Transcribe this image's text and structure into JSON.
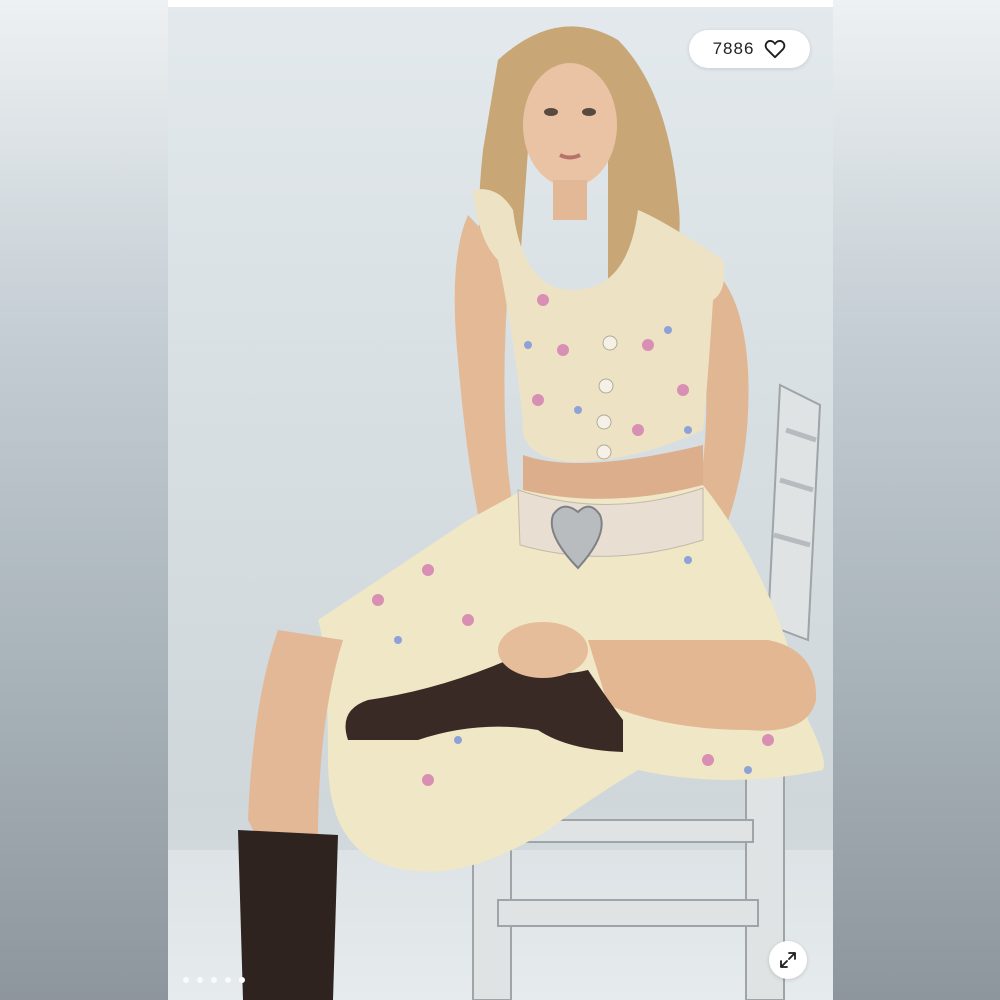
{
  "listing_photo": {
    "likes_count": "7886",
    "like_icon": "heart-outline-icon",
    "expand_icon": "expand-arrows-icon",
    "carousel": {
      "total_images": 5,
      "active_index": 4
    }
  }
}
